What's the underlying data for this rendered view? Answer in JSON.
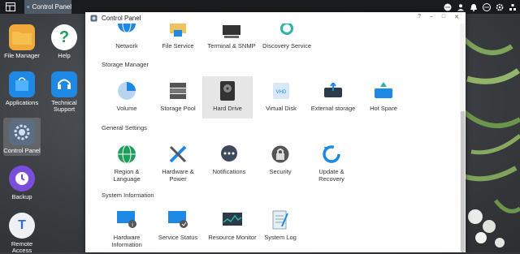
{
  "taskbar": {
    "active_app": "Control Panel"
  },
  "desktop": {
    "icons": [
      {
        "label": "File Manager"
      },
      {
        "label": "Help"
      },
      {
        "label": "Applications"
      },
      {
        "label": "Technical Support"
      },
      {
        "label": "Control Panel"
      },
      {
        "label": "Backup"
      },
      {
        "label": "Remote Access"
      }
    ]
  },
  "window": {
    "title": "Control Panel",
    "controls": [
      "?",
      "–",
      "□",
      "✕"
    ],
    "top_items": [
      "Network",
      "File Service",
      "Terminal & SNMP",
      "Discovery Service"
    ],
    "sections": [
      {
        "title": "Storage Manager",
        "items": [
          "Volume",
          "Storage Pool",
          "Hard Drive",
          "Virtual Disk",
          "External storage",
          "Hot Spare"
        ]
      },
      {
        "title": "General Settings",
        "items": [
          "Region & Language",
          "Hardware & Power",
          "Notifications",
          "Security",
          "Update & Recovery"
        ]
      },
      {
        "title": "System Information",
        "items": [
          "Hardware Information",
          "Service Status",
          "Resource Monitor",
          "System Log"
        ]
      }
    ]
  },
  "colors": {
    "accent": "#1e88e5",
    "selected_bg": "#e6e6e6"
  }
}
